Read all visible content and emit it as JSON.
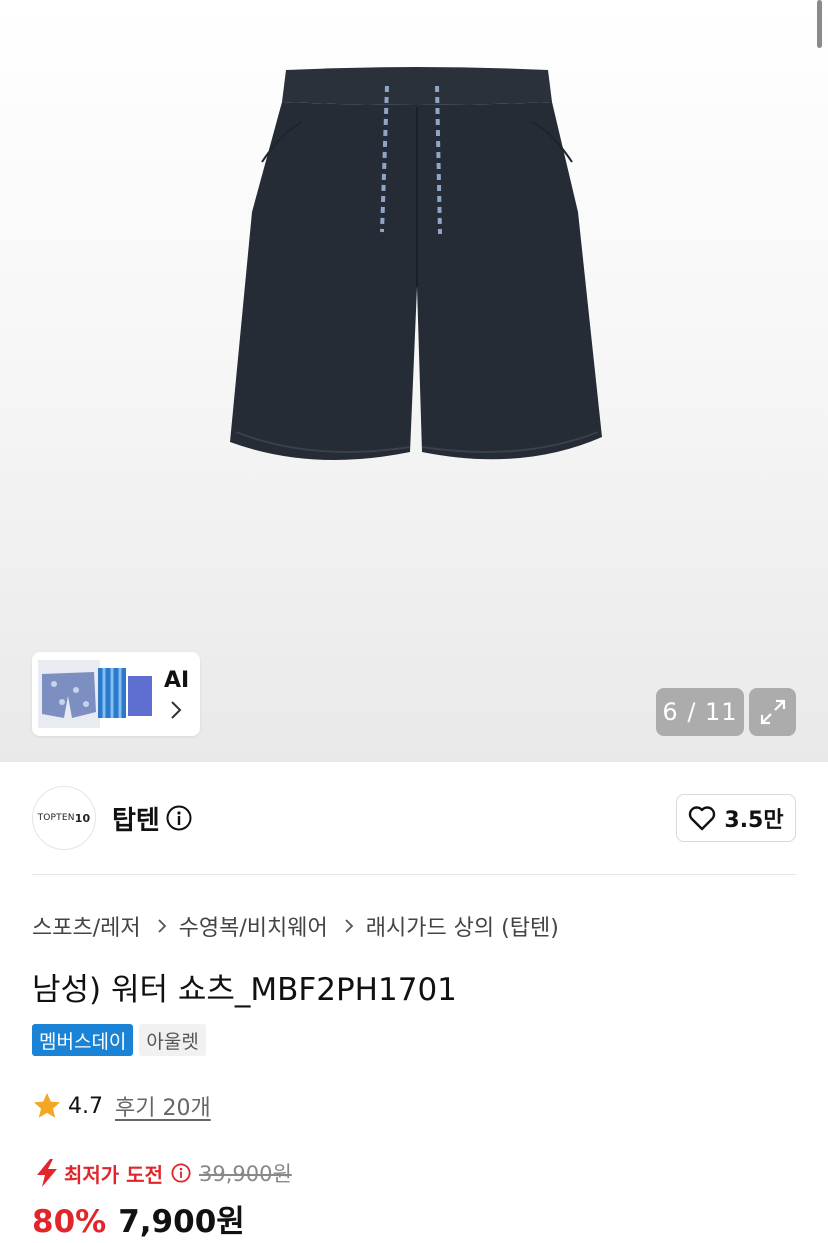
{
  "gallery": {
    "counter": "6 / 11",
    "ai_label": "AI",
    "icons": {
      "expand": "expand-icon",
      "chevron": "chevron-right-icon"
    }
  },
  "brand": {
    "logo_text": "TOPTEN",
    "logo_num": "10",
    "name": "탑텐",
    "like_count": "3.5만",
    "icons": {
      "info": "info-icon",
      "like": "heart-icon"
    }
  },
  "breadcrumb": [
    "스포츠/레저",
    "수영복/비치웨어",
    "래시가드 상의 (탑텐)"
  ],
  "product": {
    "title": "남성) 워터 쇼츠_MBF2PH1701",
    "badges": [
      "멤버스데이",
      "아울렛"
    ]
  },
  "rating": {
    "value": "4.7",
    "reviews": "후기 20개"
  },
  "price": {
    "challenge_label": "최저가 도전",
    "original": "39,900원",
    "discount": "80%",
    "sale": "7,900원"
  },
  "colors": {
    "accent_red": "#e0262b",
    "badge_blue": "#1a83d6",
    "star": "#f5a623"
  }
}
